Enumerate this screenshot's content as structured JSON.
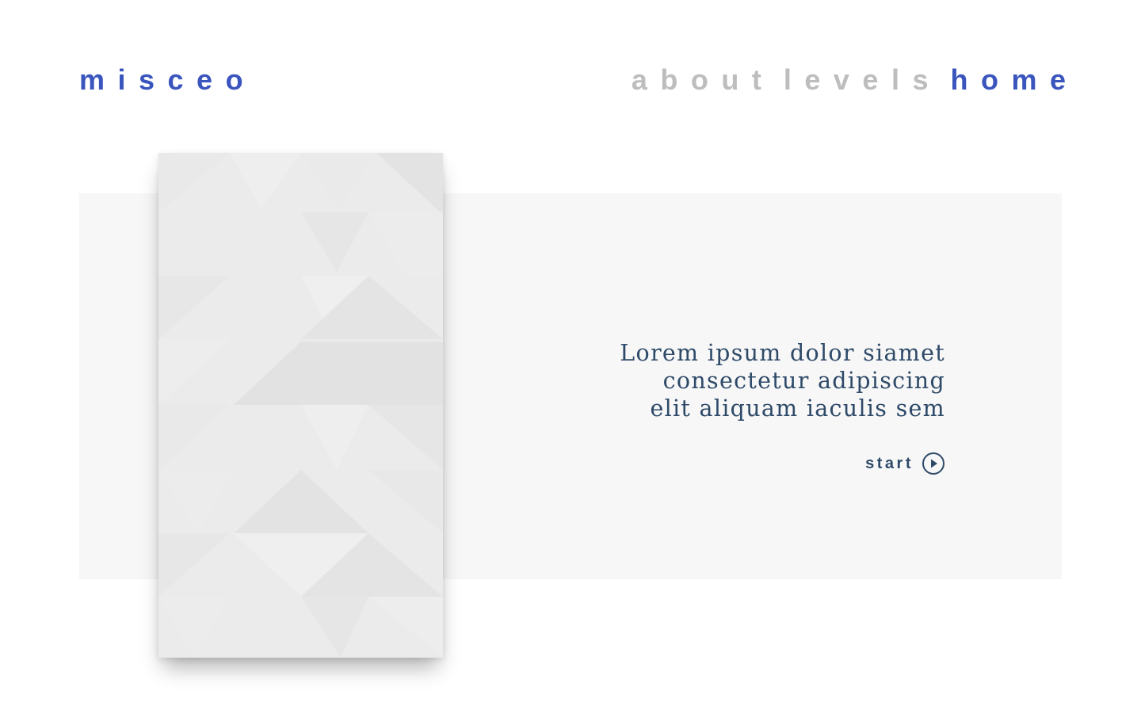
{
  "brand": {
    "name": "misceo"
  },
  "nav": {
    "items": [
      {
        "label": "about"
      },
      {
        "label": "levels"
      },
      {
        "label": "home"
      }
    ],
    "active": "home"
  },
  "hero": {
    "tagline_lines": [
      "Lorem ipsum dolor siamet",
      "consectetur adipiscing",
      "elit aliquam iaculis sem"
    ],
    "cta": {
      "label": "start",
      "icon": "play-circle-icon"
    }
  },
  "colors": {
    "accent": "#3a55bd",
    "nav_inactive": "#bdbdbd",
    "text_dark": "#2e4a68",
    "band_background": "#f7f7f7",
    "card_background": "#ebebeb"
  }
}
